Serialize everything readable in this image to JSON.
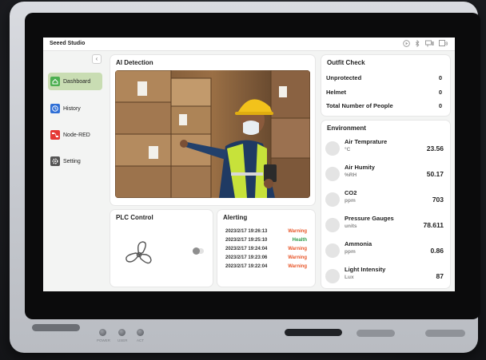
{
  "app": {
    "brand": "Seeed Studio"
  },
  "status_icons": [
    "play-icon",
    "bluetooth-icon",
    "network-icon",
    "wifi-icon"
  ],
  "sidebar": {
    "items": [
      {
        "label": "Dashboard",
        "icon": "home-icon",
        "color": "#4caf50",
        "active": true
      },
      {
        "label": "History",
        "icon": "clock-icon",
        "color": "#2f6fd6",
        "active": false
      },
      {
        "label": "Node-RED",
        "icon": "node-red-icon",
        "color": "#e53935",
        "active": false
      },
      {
        "label": "Setting",
        "icon": "gear-icon",
        "color": "#555555",
        "active": false
      }
    ]
  },
  "ai_detection": {
    "title": "AI Detection"
  },
  "outfit_check": {
    "title": "Outfit Check",
    "rows": [
      {
        "label": "Unprotected",
        "value": "0"
      },
      {
        "label": "Helmet",
        "value": "0"
      },
      {
        "label": "Total Number of People",
        "value": "0"
      }
    ]
  },
  "environment": {
    "title": "Environment",
    "rows": [
      {
        "name": "Air Temprature",
        "unit": "°C",
        "value": "23.56"
      },
      {
        "name": "Air Humity",
        "unit": "%RH",
        "value": "50.17"
      },
      {
        "name": "CO2",
        "unit": "ppm",
        "value": "703"
      },
      {
        "name": "Pressure Gauges",
        "unit": "units",
        "value": "78.611"
      },
      {
        "name": "Ammonia",
        "unit": "ppm",
        "value": "0.86"
      },
      {
        "name": "Light Intensity",
        "unit": "Lux",
        "value": "87"
      }
    ]
  },
  "plc_control": {
    "title": "PLC Control",
    "fan_icon": "fan-icon",
    "toggle_on": false
  },
  "alerting": {
    "title": "Alerting",
    "rows": [
      {
        "time": "2023/2/17 19:26:13",
        "status": "Warning",
        "color": "#e8572a"
      },
      {
        "time": "2023/2/17 19:25:10",
        "status": "Health",
        "color": "#2e9c4a"
      },
      {
        "time": "2023/2/17 19:24:04",
        "status": "Warning",
        "color": "#e8572a"
      },
      {
        "time": "2023/2/17 19:23:06",
        "status": "Warning",
        "color": "#e8572a"
      },
      {
        "time": "2023/2/17 19:22:04",
        "status": "Warning",
        "color": "#e8572a"
      }
    ]
  },
  "device": {
    "led_labels": [
      "POWER",
      "USER",
      "ACT"
    ]
  }
}
